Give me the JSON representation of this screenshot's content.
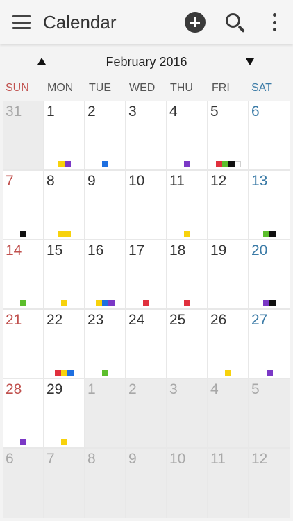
{
  "app": {
    "title": "Calendar"
  },
  "icons": {
    "menu": "menu-icon",
    "add": "add-event-icon",
    "search": "search-icon",
    "more": "more-vertical-icon",
    "prev": "prev-month-arrow-icon",
    "next": "next-month-arrow-icon"
  },
  "month_label": "February 2016",
  "weekdays": [
    {
      "label": "SUN",
      "color": "#c0504d"
    },
    {
      "label": "MON",
      "color": "#555555"
    },
    {
      "label": "TUE",
      "color": "#555555"
    },
    {
      "label": "WED",
      "color": "#555555"
    },
    {
      "label": "THU",
      "color": "#555555"
    },
    {
      "label": "FRI",
      "color": "#555555"
    },
    {
      "label": "SAT",
      "color": "#3a7aa6"
    }
  ],
  "colors": {
    "sunday": "#c0504d",
    "saturday": "#3a7aa6",
    "weekday": "#333333",
    "outside_text": "#a8a8a8",
    "cell_in": "#ffffff",
    "cell_out": "#ececec",
    "yellow": "#f7d20c",
    "purple": "#7b38c6",
    "blue": "#1e6fe0",
    "red": "#e0303d",
    "green": "#5cbe2c",
    "black": "#111111",
    "white": "#ffffff"
  },
  "days": [
    {
      "day": "31",
      "in_month": false,
      "markers": []
    },
    {
      "day": "1",
      "in_month": true,
      "markers": [
        "yellow",
        "purple"
      ]
    },
    {
      "day": "2",
      "in_month": true,
      "markers": [
        "blue"
      ]
    },
    {
      "day": "3",
      "in_month": true,
      "markers": []
    },
    {
      "day": "4",
      "in_month": true,
      "markers": [
        "purple"
      ]
    },
    {
      "day": "5",
      "in_month": true,
      "markers": [
        "red",
        "green",
        "black",
        "white"
      ]
    },
    {
      "day": "6",
      "in_month": true,
      "markers": []
    },
    {
      "day": "7",
      "in_month": true,
      "markers": [
        "black"
      ]
    },
    {
      "day": "8",
      "in_month": true,
      "markers": [
        "yellow",
        "yellow"
      ]
    },
    {
      "day": "9",
      "in_month": true,
      "markers": []
    },
    {
      "day": "10",
      "in_month": true,
      "markers": []
    },
    {
      "day": "11",
      "in_month": true,
      "markers": [
        "yellow"
      ]
    },
    {
      "day": "12",
      "in_month": true,
      "markers": []
    },
    {
      "day": "13",
      "in_month": true,
      "markers": [
        "green",
        "black"
      ]
    },
    {
      "day": "14",
      "in_month": true,
      "markers": [
        "green"
      ]
    },
    {
      "day": "15",
      "in_month": true,
      "markers": [
        "yellow"
      ]
    },
    {
      "day": "16",
      "in_month": true,
      "markers": [
        "yellow",
        "blue",
        "purple"
      ]
    },
    {
      "day": "17",
      "in_month": true,
      "markers": [
        "red"
      ]
    },
    {
      "day": "18",
      "in_month": true,
      "markers": [
        "red"
      ]
    },
    {
      "day": "19",
      "in_month": true,
      "markers": []
    },
    {
      "day": "20",
      "in_month": true,
      "markers": [
        "purple",
        "black"
      ]
    },
    {
      "day": "21",
      "in_month": true,
      "markers": []
    },
    {
      "day": "22",
      "in_month": true,
      "markers": [
        "red",
        "yellow",
        "blue"
      ]
    },
    {
      "day": "23",
      "in_month": true,
      "markers": [
        "green"
      ]
    },
    {
      "day": "24",
      "in_month": true,
      "markers": []
    },
    {
      "day": "25",
      "in_month": true,
      "markers": []
    },
    {
      "day": "26",
      "in_month": true,
      "markers": [
        "yellow"
      ]
    },
    {
      "day": "27",
      "in_month": true,
      "markers": [
        "purple"
      ]
    },
    {
      "day": "28",
      "in_month": true,
      "markers": [
        "purple"
      ]
    },
    {
      "day": "29",
      "in_month": true,
      "markers": [
        "yellow"
      ]
    },
    {
      "day": "1",
      "in_month": false,
      "markers": []
    },
    {
      "day": "2",
      "in_month": false,
      "markers": []
    },
    {
      "day": "3",
      "in_month": false,
      "markers": []
    },
    {
      "day": "4",
      "in_month": false,
      "markers": []
    },
    {
      "day": "5",
      "in_month": false,
      "markers": []
    },
    {
      "day": "6",
      "in_month": false,
      "markers": []
    },
    {
      "day": "7",
      "in_month": false,
      "markers": []
    },
    {
      "day": "8",
      "in_month": false,
      "markers": []
    },
    {
      "day": "9",
      "in_month": false,
      "markers": []
    },
    {
      "day": "10",
      "in_month": false,
      "markers": []
    },
    {
      "day": "11",
      "in_month": false,
      "markers": []
    },
    {
      "day": "12",
      "in_month": false,
      "markers": []
    }
  ]
}
